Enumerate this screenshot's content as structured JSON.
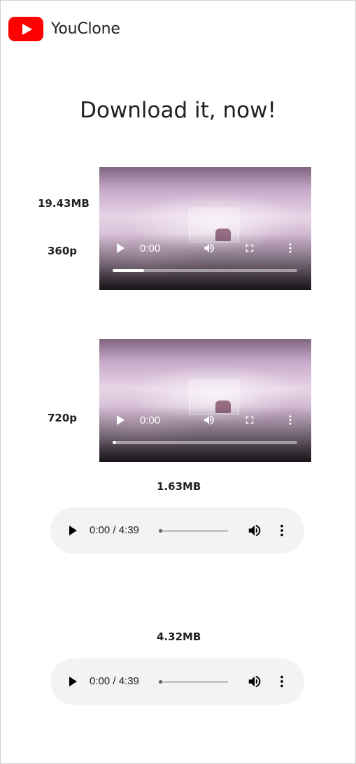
{
  "app": {
    "brand": "YouClone"
  },
  "page": {
    "title": "Download it, now!"
  },
  "videos": [
    {
      "size": "19.43MB",
      "quality": "360p",
      "time": "0:00",
      "progress": 0.17
    },
    {
      "size": "",
      "quality": "720p",
      "time": "0:00",
      "progress": 0.02
    }
  ],
  "audios": [
    {
      "size": "1.63MB",
      "time": "0:00 / 4:39",
      "progress": 0.0
    },
    {
      "size": "4.32MB",
      "time": "0:00 / 4:39",
      "progress": 0.0
    }
  ],
  "icons": {
    "logo": "play-logo-icon",
    "play": "play-icon",
    "volume": "volume-icon",
    "fullscreen": "fullscreen-icon",
    "more": "more-vert-icon"
  },
  "colors": {
    "brand_red": "#ff0000",
    "audio_bg": "#f1f3f4"
  }
}
